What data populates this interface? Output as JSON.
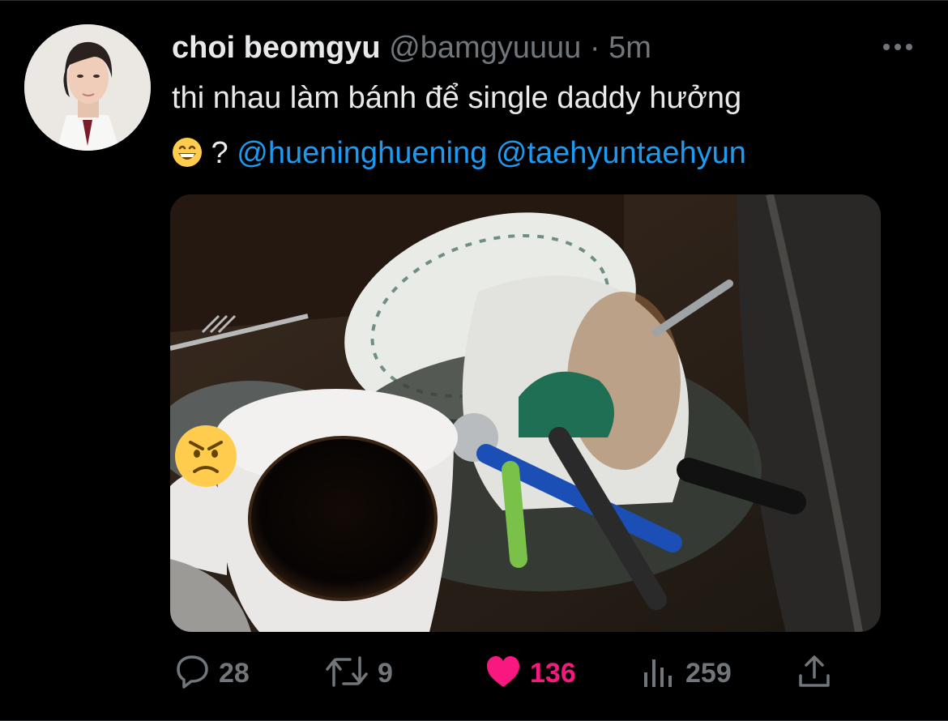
{
  "tweet": {
    "display_name": "choi beomgyu",
    "handle": "@bamgyuuuu",
    "separator": "·",
    "time": "5m",
    "text_line1": "thi nhau làm bánh để single daddy hưởng",
    "emoji": "😁",
    "text_after_emoji": " ? ",
    "mention_1": "@hueninghuening",
    "mention_2": "@taehyuntaehyun",
    "more_icon": "ellipsis-icon",
    "image_overlay_emoji": "😠"
  },
  "actions": {
    "replies": "28",
    "retweets": "9",
    "likes": "136",
    "views": "259",
    "liked": true
  },
  "colors": {
    "background": "#000000",
    "text": "#e7e9ea",
    "muted": "#71767b",
    "link": "#1d9bf0",
    "like": "#f91880"
  }
}
